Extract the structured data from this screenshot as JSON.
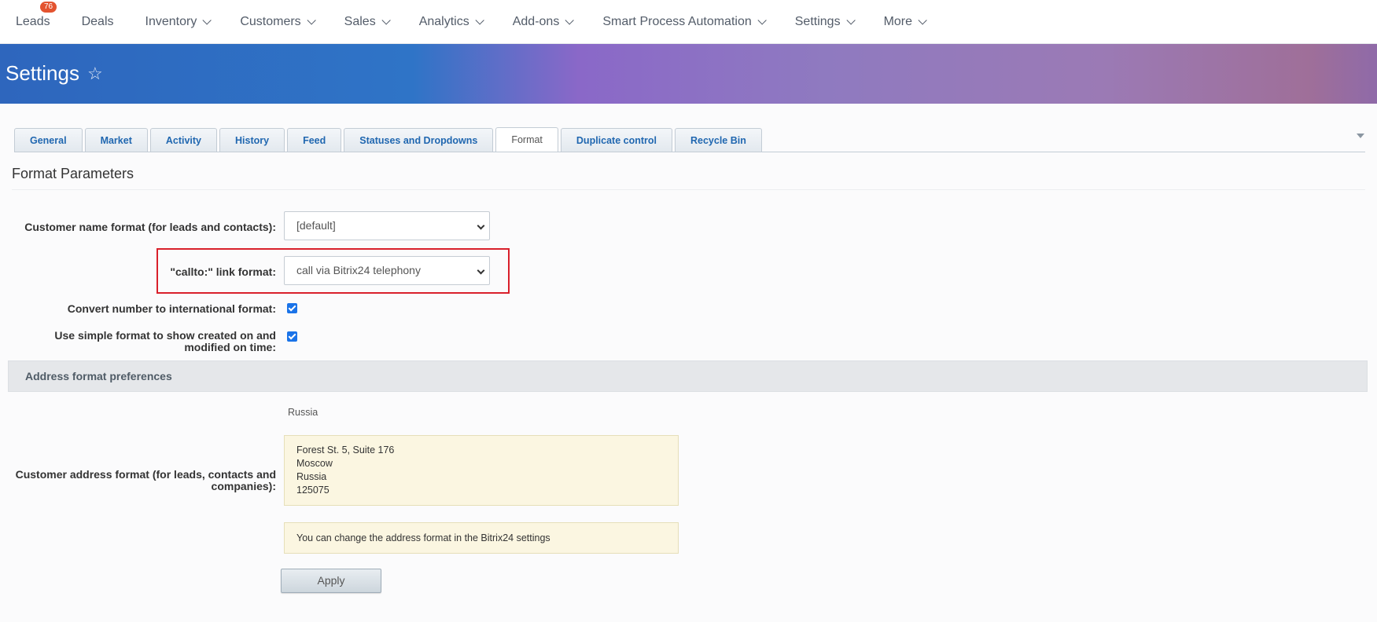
{
  "nav": {
    "items": [
      {
        "label": "Leads",
        "badge": "76",
        "dropdown": false
      },
      {
        "label": "Deals",
        "dropdown": false
      },
      {
        "label": "Inventory",
        "dropdown": true
      },
      {
        "label": "Customers",
        "dropdown": true
      },
      {
        "label": "Sales",
        "dropdown": true
      },
      {
        "label": "Analytics",
        "dropdown": true
      },
      {
        "label": "Add-ons",
        "dropdown": true
      },
      {
        "label": "Smart Process Automation",
        "dropdown": true
      },
      {
        "label": "Settings",
        "dropdown": true
      },
      {
        "label": "More",
        "dropdown": true
      }
    ]
  },
  "header": {
    "title": "Settings",
    "star_icon": "star-outline-icon"
  },
  "tabs": [
    {
      "label": "General",
      "active": false
    },
    {
      "label": "Market",
      "active": false
    },
    {
      "label": "Activity",
      "active": false
    },
    {
      "label": "History",
      "active": false
    },
    {
      "label": "Feed",
      "active": false
    },
    {
      "label": "Statuses and Dropdowns",
      "active": false
    },
    {
      "label": "Format",
      "active": true
    },
    {
      "label": "Duplicate control",
      "active": false
    },
    {
      "label": "Recycle Bin",
      "active": false
    }
  ],
  "form": {
    "section_title": "Format Parameters",
    "name_format_label": "Customer name format (for leads and contacts):",
    "name_format_value": "[default]",
    "callto_label": "\"callto:\" link format:",
    "callto_value": "call via Bitrix24 telephony",
    "intl_label": "Convert number to international format:",
    "intl_checked": true,
    "simple_format_label": "Use simple format to show created on and modified on time:",
    "simple_format_checked": true,
    "address_section_title": "Address format preferences",
    "address_country": "Russia",
    "address_format_label": "Customer address format (for leads, contacts and companies):",
    "address_lines": [
      "Forest St. 5, Suite 176",
      "Moscow",
      "Russia",
      "125075"
    ],
    "address_note": "You can change the address format in the Bitrix24 settings",
    "apply_label": "Apply"
  },
  "colors": {
    "highlight": "#d9202b",
    "badge": "#e3532f",
    "checkbox": "#1a73e8"
  }
}
